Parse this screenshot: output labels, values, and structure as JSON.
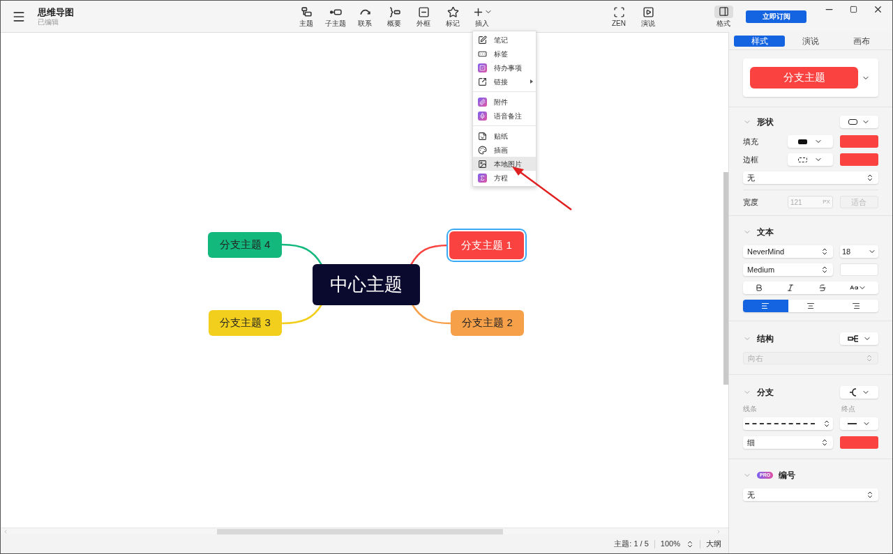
{
  "window": {
    "title": "思维导图",
    "subtitle": "已编辑"
  },
  "toolbar": {
    "tools": [
      {
        "kind": "topic",
        "label": "主题"
      },
      {
        "kind": "subtopic",
        "label": "子主题"
      },
      {
        "kind": "relation",
        "label": "联系"
      },
      {
        "kind": "summary",
        "label": "概要"
      },
      {
        "kind": "boundary",
        "label": "外框"
      },
      {
        "kind": "marker",
        "label": "标记"
      },
      {
        "kind": "insert",
        "label": "插入"
      }
    ],
    "view_tools": [
      {
        "kind": "zen",
        "label": "ZEN"
      },
      {
        "kind": "pitch",
        "label": "演说"
      }
    ],
    "format": {
      "label": "格式",
      "selected": true
    },
    "subscribe": "立即订阅"
  },
  "insert_menu": {
    "groups": [
      [
        {
          "kind": "note",
          "label": "笔记",
          "submenu": false,
          "selected": false
        },
        {
          "kind": "label",
          "label": "标签",
          "submenu": false,
          "selected": false
        },
        {
          "kind": "todo",
          "label": "待办事项",
          "submenu": false,
          "selected": false
        },
        {
          "kind": "link",
          "label": "链接",
          "submenu": true,
          "selected": false
        }
      ],
      [
        {
          "kind": "attachment",
          "label": "附件",
          "submenu": false,
          "selected": false
        },
        {
          "kind": "audio",
          "label": "语音备注",
          "submenu": false,
          "selected": false
        }
      ],
      [
        {
          "kind": "sticker",
          "label": "贴纸",
          "submenu": false,
          "selected": false
        },
        {
          "kind": "illustration",
          "label": "插画",
          "submenu": false,
          "selected": false
        },
        {
          "kind": "image",
          "label": "本地图片",
          "submenu": false,
          "selected": true
        },
        {
          "kind": "equation",
          "label": "方程",
          "submenu": false,
          "selected": false
        }
      ]
    ]
  },
  "mindmap": {
    "central": "中心主题",
    "branches": [
      {
        "text": "分支主题 4",
        "color": "#12b87c",
        "selected": false
      },
      {
        "text": "分支主题 1",
        "color": "#fa4340",
        "selected": true
      },
      {
        "text": "分支主题 3",
        "color": "#f2cf1c",
        "selected": false
      },
      {
        "text": "分支主题 2",
        "color": "#f7a04a",
        "selected": false
      }
    ]
  },
  "panel": {
    "tabs": [
      {
        "label": "样式",
        "selected": true
      },
      {
        "label": "演说",
        "selected": false
      },
      {
        "label": "画布",
        "selected": false
      }
    ],
    "preview": {
      "text": "分支主题"
    },
    "shape": {
      "title": "形状",
      "fill_label": "填充",
      "border_label": "边框",
      "border_option": "无",
      "width_label": "宽度",
      "width_value": "121",
      "width_unit": "PX",
      "fit_button": "适合",
      "fit_disabled": true
    },
    "text": {
      "title": "文本",
      "font": "NeverMind",
      "size": "18",
      "weight": "Medium",
      "align": [
        {
          "kind": "left",
          "selected": true
        },
        {
          "kind": "center",
          "selected": false
        },
        {
          "kind": "right",
          "selected": false
        }
      ]
    },
    "structure": {
      "title": "结构",
      "direction": "向右",
      "direction_disabled": true
    },
    "branch": {
      "title": "分支",
      "line_label": "线条",
      "end_label": "终点",
      "thickness": "细"
    },
    "numbering": {
      "badge": "PRO",
      "title": "编号",
      "value": "无"
    }
  },
  "status_bar": {
    "topics": "主题: 1 / 5",
    "zoom": "100%",
    "outline": "大纲"
  }
}
